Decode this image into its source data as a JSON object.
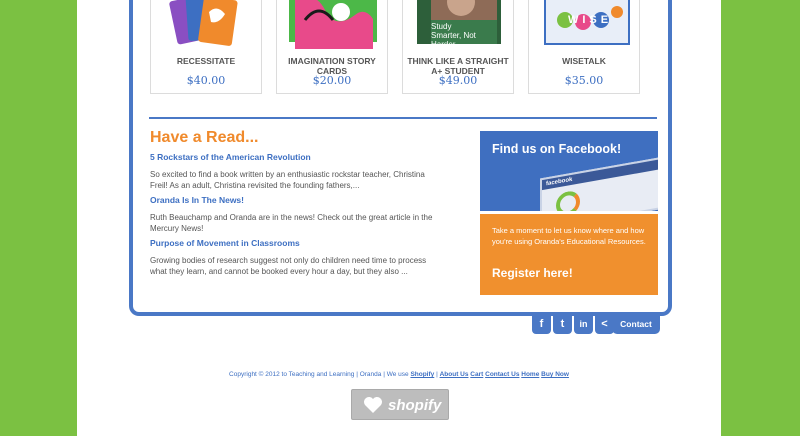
{
  "products": [
    {
      "name": "RECESSITATE",
      "price": "$40.00",
      "icon": "game-box-image"
    },
    {
      "name": "IMAGINATION STORY CARDS",
      "price": "$20.00",
      "icon": "story-cards-image"
    },
    {
      "name": "THINK LIKE A STRAIGHT A+ STUDENT",
      "price": "$49.00",
      "icon": "dvd-cover-image",
      "cover_text": "Study Smarter, Not Harder"
    },
    {
      "name": "WISETALK",
      "price": "$35.00",
      "icon": "wisetalk-box-image",
      "cover_text": "WISE"
    }
  ],
  "read": {
    "title": "Have a Read...",
    "posts": [
      {
        "title": "5 Rockstars of the American Revolution",
        "excerpt": "So excited to find a book written by an enthusiastic rockstar teacher, Christina Freil!  As an adult, Christina revisited the founding fathers,..."
      },
      {
        "title": "Oranda Is In The News!",
        "excerpt": "Ruth Beauchamp and Oranda are in the news!  Check out the great article in the Mercury News!"
      },
      {
        "title": "Purpose of Movement in Classrooms",
        "excerpt": "Growing bodies of research suggest not only do children need time to process what they learn, and cannot be booked every hour a day, but they also ..."
      }
    ]
  },
  "facebook": {
    "title": "Find us on Facebook!",
    "screenshot_brand": "facebook"
  },
  "register": {
    "text": "Take a moment to let us know where and how you're using Oranda's Educational Resources.",
    "link": "Register here!"
  },
  "social": {
    "icons": [
      {
        "name": "facebook-icon",
        "glyph": "f"
      },
      {
        "name": "twitter-icon",
        "glyph": "t"
      },
      {
        "name": "linkedin-icon",
        "glyph": "in"
      },
      {
        "name": "share-icon",
        "glyph": "<"
      }
    ],
    "contact": "Contact"
  },
  "footer": {
    "copyright": "Copyright © 2012 to Teaching and Learning | Oranda | We use",
    "shopify_link": "Shopify",
    "sep": " | ",
    "links": [
      "About Us",
      "Cart",
      "Contact Us",
      "Home",
      "Buy Now"
    ]
  },
  "badge": {
    "label": "shopify"
  },
  "colors": {
    "background": "#7bc142",
    "accent_blue": "#4a78c6",
    "accent_orange": "#f08a2c"
  }
}
